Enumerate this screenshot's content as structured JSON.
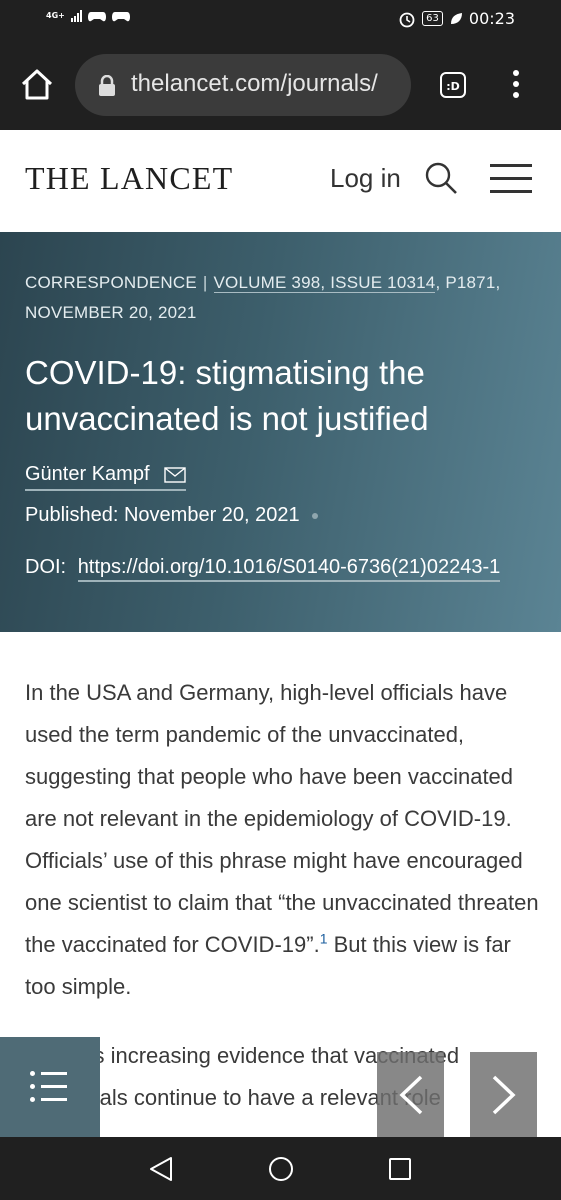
{
  "status_bar": {
    "network": "4G+",
    "battery": "63",
    "time": "00:23"
  },
  "browser": {
    "url": "thelancet.com/journals/",
    "tabs_label": ":D"
  },
  "site": {
    "logo": "THE LANCET",
    "login": "Log in"
  },
  "article": {
    "section": "CORRESPONDENCE",
    "citation": "VOLUME 398, ISSUE 10314",
    "page": ", P1871,",
    "date_line": "NOVEMBER 20, 2021",
    "title": "COVID-19: stigmatising the unvaccinated is not justified",
    "author": "Günter Kampf",
    "published_label": "Published:",
    "published_date": "November 20, 2021",
    "doi_label": "DOI:",
    "doi_url": "https://doi.org/10.1016/S0140-6736(21)02243-1",
    "paragraph1_text": "In the USA and Germany, high-level officials have used the term pandemic of the unvaccinated, suggesting that people who have been vaccinated are not relevant in the epidemiology of COVID-19. Officials’ use of this phrase might have encouraged one scientist to claim that “the unvaccinated threaten the vaccinated for COVID-19”.",
    "paragraph1_ref": "1",
    "paragraph1_tail": " But this view is far too simple.",
    "paragraph2_line1": "There is increasing evidence that vaccinated",
    "paragraph2_line2": "individuals continue to have a relevant role"
  },
  "icons": {
    "home": "home-icon",
    "lock": "lock-icon",
    "menu": "more-vert-icon",
    "search": "search-icon",
    "hamburger": "hamburger-menu-icon",
    "email": "email-icon",
    "toc": "list-icon",
    "prev": "chevron-left-icon",
    "next": "chevron-right-icon"
  },
  "colors": {
    "hero_dark": "#2c4550",
    "hero_light": "#5b8494",
    "toc": "#4f6b76",
    "link": "#1b5e9e"
  }
}
